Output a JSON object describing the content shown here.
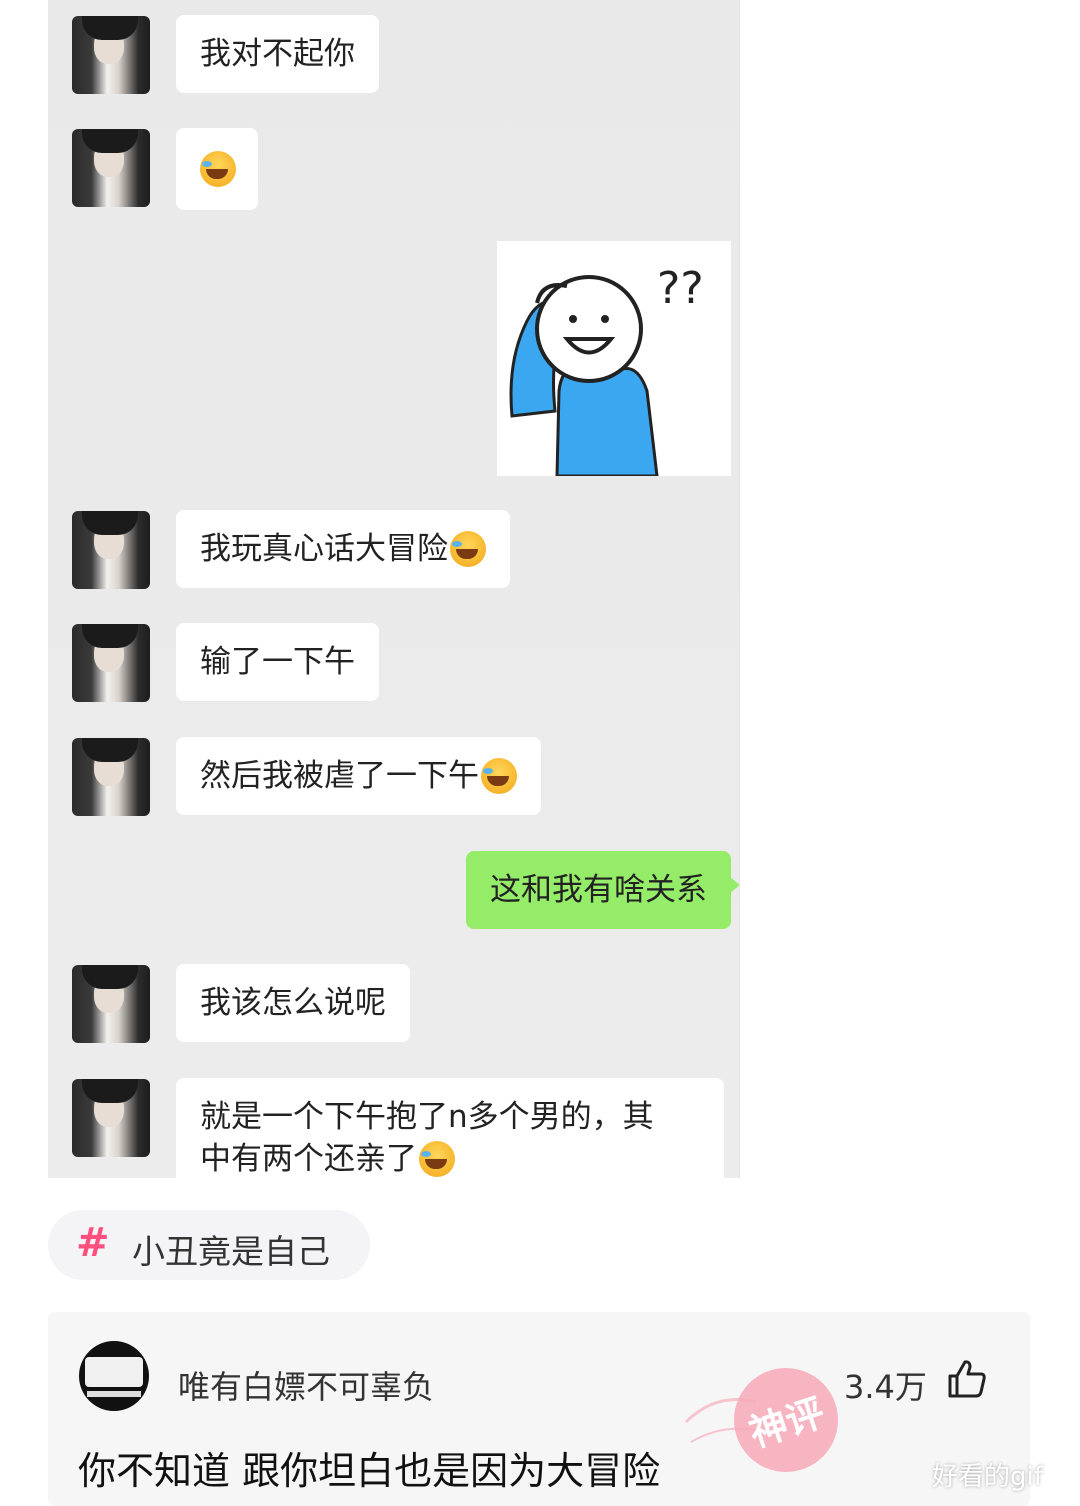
{
  "chat": {
    "messages": [
      {
        "text": "我对不起你"
      },
      {
        "text": ""
      },
      {
        "text": "我玩真心话大冒险"
      },
      {
        "text": "输了一下午"
      },
      {
        "text": "然后我被虐了一下午"
      },
      {
        "text": "这和我有啥关系"
      },
      {
        "text": "我该怎么说呢"
      },
      {
        "line1": "就是一个下午抱了n多个男的，其",
        "line2": "中有两个还亲了"
      }
    ],
    "sticker_marks": "??"
  },
  "topic": {
    "hash": "#",
    "label": "小丑竟是自己"
  },
  "comment": {
    "username": "唯有白嫖不可辜负",
    "likes": "3.4万",
    "text": "你不知道 跟你坦白也是因为大冒险",
    "badge": "神评"
  },
  "watermark": "好看的gif",
  "colors": {
    "my_bubble": "#95ec69",
    "hashtag": "#ff4f7e",
    "badge": "#f7a9b8"
  }
}
